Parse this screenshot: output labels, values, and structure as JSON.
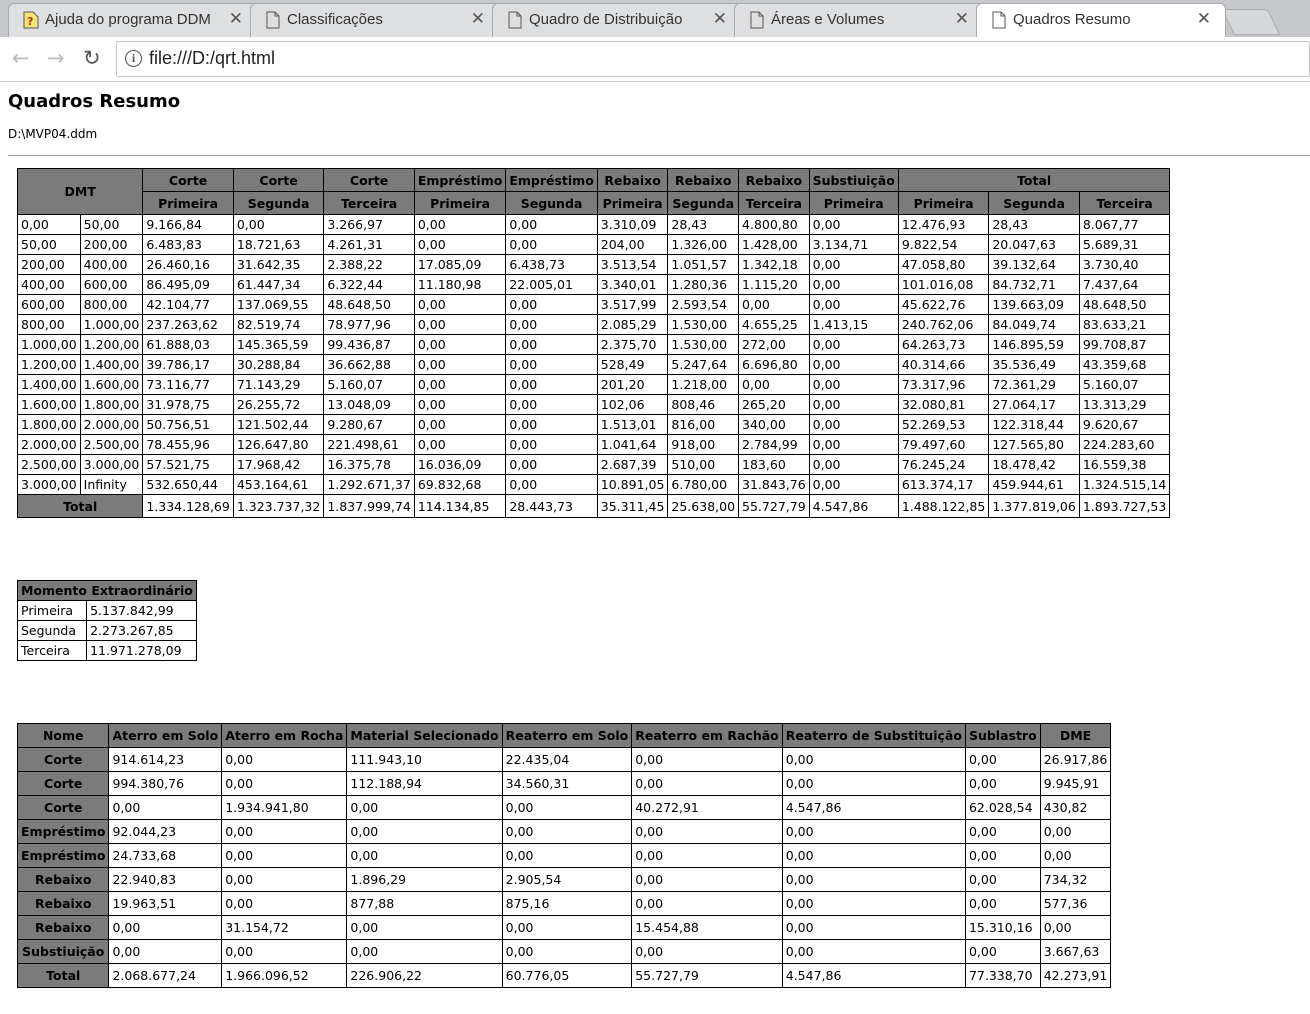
{
  "tabs": [
    {
      "label": "Ajuda do programa DDM",
      "icon": "help-document-icon"
    },
    {
      "label": "Classificações",
      "icon": "document-icon"
    },
    {
      "label": "Quadro de Distribuição",
      "icon": "document-icon"
    },
    {
      "label": "Áreas e Volumes",
      "icon": "document-icon"
    },
    {
      "label": "Quadros Resumo",
      "icon": "document-icon"
    }
  ],
  "address": {
    "url": "file:///D:/qrt.html"
  },
  "page": {
    "title": "Quadros Resumo",
    "file": "D:\\MVP04.ddm"
  },
  "dmt_table": {
    "dmt_header": "DMT",
    "groups": [
      "Corte",
      "Corte",
      "Corte",
      "Empréstimo",
      "Empréstimo",
      "Rebaixo",
      "Rebaixo",
      "Rebaixo",
      "Substiuição",
      "Total"
    ],
    "subheaders": [
      "Primeira",
      "Segunda",
      "Terceira",
      "Primeira",
      "Segunda",
      "Primeira",
      "Segunda",
      "Terceira",
      "Primeira",
      "Primeira",
      "Segunda",
      "Terceira"
    ],
    "rows": [
      [
        "0,00",
        "50,00",
        "9.166,84",
        "0,00",
        "3.266,97",
        "0,00",
        "0,00",
        "3.310,09",
        "28,43",
        "4.800,80",
        "0,00",
        "12.476,93",
        "28,43",
        "8.067,77"
      ],
      [
        "50,00",
        "200,00",
        "6.483,83",
        "18.721,63",
        "4.261,31",
        "0,00",
        "0,00",
        "204,00",
        "1.326,00",
        "1.428,00",
        "3.134,71",
        "9.822,54",
        "20.047,63",
        "5.689,31"
      ],
      [
        "200,00",
        "400,00",
        "26.460,16",
        "31.642,35",
        "2.388,22",
        "17.085,09",
        "6.438,73",
        "3.513,54",
        "1.051,57",
        "1.342,18",
        "0,00",
        "47.058,80",
        "39.132,64",
        "3.730,40"
      ],
      [
        "400,00",
        "600,00",
        "86.495,09",
        "61.447,34",
        "6.322,44",
        "11.180,98",
        "22.005,01",
        "3.340,01",
        "1.280,36",
        "1.115,20",
        "0,00",
        "101.016,08",
        "84.732,71",
        "7.437,64"
      ],
      [
        "600,00",
        "800,00",
        "42.104,77",
        "137.069,55",
        "48.648,50",
        "0,00",
        "0,00",
        "3.517,99",
        "2.593,54",
        "0,00",
        "0,00",
        "45.622,76",
        "139.663,09",
        "48.648,50"
      ],
      [
        "800,00",
        "1.000,00",
        "237.263,62",
        "82.519,74",
        "78.977,96",
        "0,00",
        "0,00",
        "2.085,29",
        "1.530,00",
        "4.655,25",
        "1.413,15",
        "240.762,06",
        "84.049,74",
        "83.633,21"
      ],
      [
        "1.000,00",
        "1.200,00",
        "61.888,03",
        "145.365,59",
        "99.436,87",
        "0,00",
        "0,00",
        "2.375,70",
        "1.530,00",
        "272,00",
        "0,00",
        "64.263,73",
        "146.895,59",
        "99.708,87"
      ],
      [
        "1.200,00",
        "1.400,00",
        "39.786,17",
        "30.288,84",
        "36.662,88",
        "0,00",
        "0,00",
        "528,49",
        "5.247,64",
        "6.696,80",
        "0,00",
        "40.314,66",
        "35.536,49",
        "43.359,68"
      ],
      [
        "1.400,00",
        "1.600,00",
        "73.116,77",
        "71.143,29",
        "5.160,07",
        "0,00",
        "0,00",
        "201,20",
        "1.218,00",
        "0,00",
        "0,00",
        "73.317,96",
        "72.361,29",
        "5.160,07"
      ],
      [
        "1.600,00",
        "1.800,00",
        "31.978,75",
        "26.255,72",
        "13.048,09",
        "0,00",
        "0,00",
        "102,06",
        "808,46",
        "265,20",
        "0,00",
        "32.080,81",
        "27.064,17",
        "13.313,29"
      ],
      [
        "1.800,00",
        "2.000,00",
        "50.756,51",
        "121.502,44",
        "9.280,67",
        "0,00",
        "0,00",
        "1.513,01",
        "816,00",
        "340,00",
        "0,00",
        "52.269,53",
        "122.318,44",
        "9.620,67"
      ],
      [
        "2.000,00",
        "2.500,00",
        "78.455,96",
        "126.647,80",
        "221.498,61",
        "0,00",
        "0,00",
        "1.041,64",
        "918,00",
        "2.784,99",
        "0,00",
        "79.497,60",
        "127.565,80",
        "224.283,60"
      ],
      [
        "2.500,00",
        "3.000,00",
        "57.521,75",
        "17.968,42",
        "16.375,78",
        "16.036,09",
        "0,00",
        "2.687,39",
        "510,00",
        "183,60",
        "0,00",
        "76.245,24",
        "18.478,42",
        "16.559,38"
      ],
      [
        "3.000,00",
        "Infinity",
        "532.650,44",
        "453.164,61",
        "1.292.671,37",
        "69.832,68",
        "0,00",
        "10.891,05",
        "6.780,00",
        "31.843,76",
        "0,00",
        "613.374,17",
        "459.944,61",
        "1.324.515,14"
      ]
    ],
    "total_label": "Total",
    "total": [
      "1.334.128,69",
      "1.323.737,32",
      "1.837.999,74",
      "114.134,85",
      "28.443,73",
      "35.311,45",
      "25.638,00",
      "55.727,79",
      "4.547,86",
      "1.488.122,85",
      "1.377.819,06",
      "1.893.727,53"
    ]
  },
  "momento_table": {
    "header": "Momento Extraordinário",
    "rows": [
      [
        "Primeira",
        "5.137.842,99"
      ],
      [
        "Segunda",
        "2.273.267,85"
      ],
      [
        "Terceira",
        "11.971.278,09"
      ]
    ]
  },
  "materials_table": {
    "headers": [
      "Nome",
      "Aterro em Solo",
      "Aterro em Rocha",
      "Material Selecionado",
      "Reaterro em Solo",
      "Reaterro em Rachão",
      "Reaterro de Substituição",
      "Sublastro",
      "DME"
    ],
    "rows": [
      [
        "Corte",
        "914.614,23",
        "0,00",
        "111.943,10",
        "22.435,04",
        "0,00",
        "0,00",
        "0,00",
        "26.917,86"
      ],
      [
        "Corte",
        "994.380,76",
        "0,00",
        "112.188,94",
        "34.560,31",
        "0,00",
        "0,00",
        "0,00",
        "9.945,91"
      ],
      [
        "Corte",
        "0,00",
        "1.934.941,80",
        "0,00",
        "0,00",
        "40.272,91",
        "4.547,86",
        "62.028,54",
        "430,82"
      ],
      [
        "Empréstimo",
        "92.044,23",
        "0,00",
        "0,00",
        "0,00",
        "0,00",
        "0,00",
        "0,00",
        "0,00"
      ],
      [
        "Empréstimo",
        "24.733,68",
        "0,00",
        "0,00",
        "0,00",
        "0,00",
        "0,00",
        "0,00",
        "0,00"
      ],
      [
        "Rebaixo",
        "22.940,83",
        "0,00",
        "1.896,29",
        "2.905,54",
        "0,00",
        "0,00",
        "0,00",
        "734,32"
      ],
      [
        "Rebaixo",
        "19.963,51",
        "0,00",
        "877,88",
        "875,16",
        "0,00",
        "0,00",
        "0,00",
        "577,36"
      ],
      [
        "Rebaixo",
        "0,00",
        "31.154,72",
        "0,00",
        "0,00",
        "15.454,88",
        "0,00",
        "15.310,16",
        "0,00"
      ],
      [
        "Substiuição",
        "0,00",
        "0,00",
        "0,00",
        "0,00",
        "0,00",
        "0,00",
        "0,00",
        "3.667,63"
      ],
      [
        "Total",
        "2.068.677,24",
        "1.966.096,52",
        "226.906,22",
        "60.776,05",
        "55.727,79",
        "4.547,86",
        "77.338,70",
        "42.273,91"
      ]
    ]
  }
}
